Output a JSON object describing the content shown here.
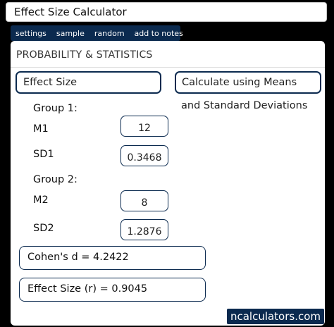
{
  "window": {
    "title": "Effect Size Calculator"
  },
  "menu": {
    "items": [
      "settings",
      "sample",
      "random",
      "add to notes"
    ]
  },
  "panel": {
    "header": "PROBABILITY & STATISTICS"
  },
  "calc": {
    "name": "Effect Size",
    "method_line1": "Calculate using Means",
    "method_line2": "and Standard Deviations"
  },
  "group1": {
    "label": "Group 1:",
    "m_label": "M1",
    "m_value": "12",
    "sd_label": "SD1",
    "sd_value": "0.3468"
  },
  "group2": {
    "label": "Group 2:",
    "m_label": "M2",
    "m_value": "8",
    "sd_label": "SD2",
    "sd_value": "1.2876"
  },
  "results": {
    "cohens_d": "Cohen's d  =  4.2422",
    "effect_size_r": "Effect Size (r)  =  0.9045"
  },
  "brand": "ncalculators.com"
}
